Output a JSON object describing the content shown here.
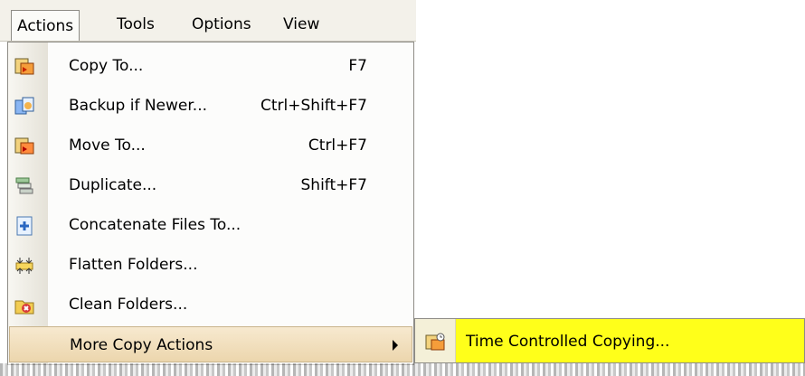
{
  "menubar": {
    "items": [
      {
        "label": "Actions",
        "name": "menubar-actions"
      },
      {
        "label": "Tools",
        "name": "menubar-tools"
      },
      {
        "label": "Options",
        "name": "menubar-options"
      },
      {
        "label": "View",
        "name": "menubar-view"
      }
    ]
  },
  "actions_menu": {
    "items": [
      {
        "label": "Copy To...",
        "shortcut": "F7",
        "icon": "copy-to-icon"
      },
      {
        "label": "Backup if Newer...",
        "shortcut": "Ctrl+Shift+F7",
        "icon": "backup-icon"
      },
      {
        "label": "Move To...",
        "shortcut": "Ctrl+F7",
        "icon": "move-to-icon"
      },
      {
        "label": "Duplicate...",
        "shortcut": "Shift+F7",
        "icon": "duplicate-icon"
      },
      {
        "label": "Concatenate Files To...",
        "shortcut": "",
        "icon": "concatenate-icon"
      },
      {
        "label": "Flatten Folders...",
        "shortcut": "",
        "icon": "flatten-folders-icon"
      },
      {
        "label": "Clean Folders...",
        "shortcut": "",
        "icon": "clean-folders-icon"
      },
      {
        "label": "More Copy Actions",
        "shortcut": "",
        "icon": ""
      }
    ]
  },
  "submenu": {
    "items": [
      {
        "label": "Time Controlled Copying...",
        "icon": "time-controlled-copy-icon"
      }
    ]
  }
}
